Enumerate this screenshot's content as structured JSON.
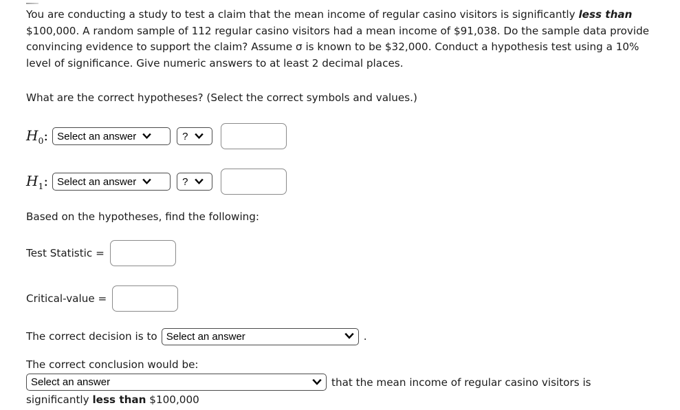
{
  "problem": {
    "segments": [
      {
        "text": "You are conducting a study to test a claim that the mean income of regular casino visitors is significantly ",
        "style": "normal"
      },
      {
        "text": "less than",
        "style": "bold-italic"
      },
      {
        "text": " $100,000. A random sample of 112 regular casino visitors had a mean income of $91,038. Do the sample data provide convincing evidence to support the claim? Assume σ is known to be $32,000. Conduct a hypothesis test using a 10% level of significance. Give numeric answers to at least 2 decimal places.",
        "style": "normal"
      }
    ],
    "plain": "You are conducting a study to test a claim that the mean income of regular casino visitors is significantly less than $100,000. A random sample of 112 regular casino visitors had a mean income of $91,038. Do the sample data provide convincing evidence to support the claim? Assume σ is known to be $32,000. Conduct a hypothesis test using a 10% level of significance. Give numeric answers to at least 2 decimal places.",
    "claim_value": "$100,000",
    "sample_size": "112",
    "sample_mean": "$91,038",
    "sigma": "$32,000",
    "significance_level": "10%",
    "decimal_places": "2"
  },
  "hypotheses": {
    "question": "What are the correct hypotheses? (Select the correct symbols and values.)",
    "rows": [
      {
        "label_base": "H",
        "label_sub": "0",
        "label_colon": ":",
        "parameter_select": "Select an answer",
        "operator_select": "?",
        "value_input": "",
        "value_placeholder": ""
      },
      {
        "label_base": "H",
        "label_sub": "1",
        "label_colon": ":",
        "parameter_select": "Select an answer",
        "operator_select": "?",
        "value_input": "",
        "value_placeholder": ""
      }
    ]
  },
  "findings": {
    "prompt": "Based on the hypotheses, find the following:",
    "items": [
      {
        "label": "Test Statistic =",
        "value": "",
        "placeholder": ""
      },
      {
        "label": "Critical-value =",
        "value": "",
        "placeholder": ""
      }
    ]
  },
  "decision": {
    "lead": "The correct decision is to",
    "select": "Select an answer",
    "trailing_punctuation": "."
  },
  "conclusion": {
    "lead": "The correct conclusion would be:",
    "select": "Select an answer",
    "trailing": "that the mean income of regular casino visitors is",
    "tail_segments": [
      {
        "text": "significantly ",
        "style": "normal"
      },
      {
        "text": "less than",
        "style": "bold"
      },
      {
        "text": " $100,000",
        "style": "normal"
      }
    ],
    "tail_plain": "significantly less than $100,000"
  },
  "icons": {
    "chevron_down": "chevron-down-icon"
  },
  "colors": {
    "text": "#1b1b1b",
    "select_border": "#4a4a4a",
    "input_border": "#8a8a8a",
    "background": "#ffffff"
  }
}
